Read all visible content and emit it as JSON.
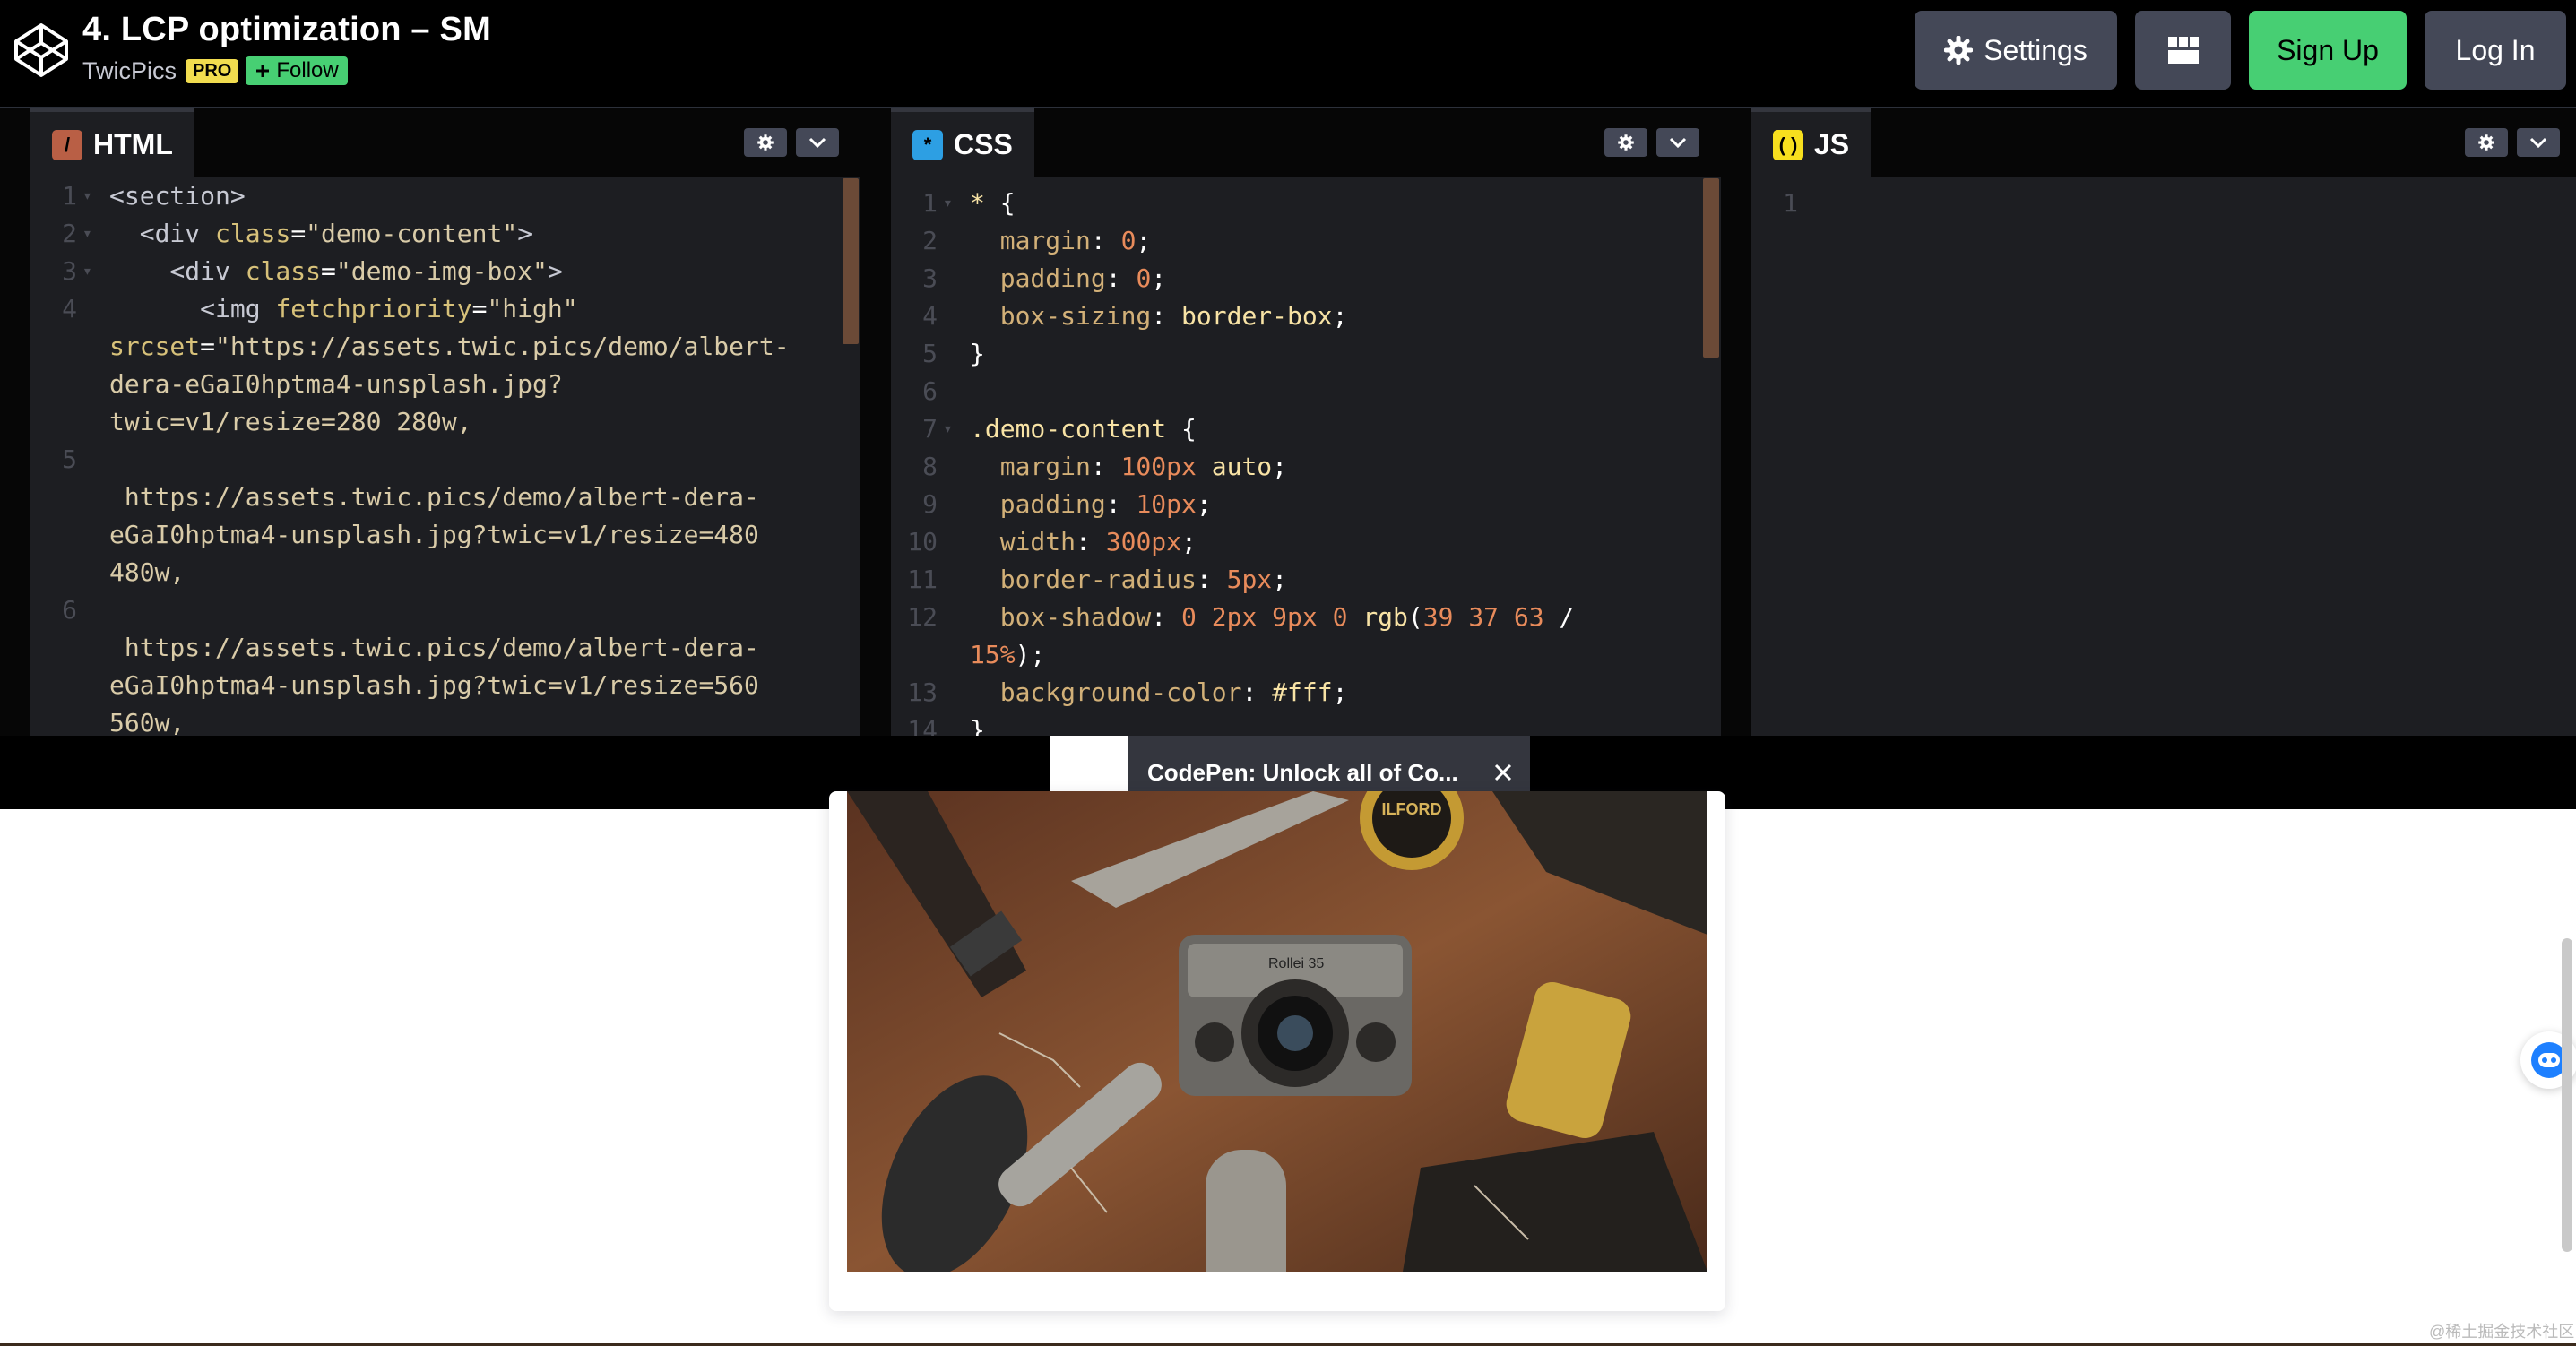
{
  "header": {
    "title": "4. LCP optimization – SM",
    "author": "TwicPics",
    "pro_badge": "PRO",
    "follow_label": "Follow",
    "settings_label": "Settings",
    "signup_label": "Sign Up",
    "login_label": "Log In"
  },
  "panels": {
    "html": {
      "label": "HTML",
      "icon": "/"
    },
    "css": {
      "label": "CSS",
      "icon": "*"
    },
    "js": {
      "label": "JS",
      "icon": "( )"
    }
  },
  "html_code": [
    {
      "n": "1",
      "fold": true,
      "parts": [
        [
          "c-tag",
          "<section>"
        ]
      ]
    },
    {
      "n": "2",
      "fold": true,
      "parts": [
        [
          "c-tag",
          "  <div "
        ],
        [
          "c-attr",
          "class"
        ],
        [
          "c-def",
          "="
        ],
        [
          "c-str",
          "\"demo-content\""
        ],
        [
          "c-tag",
          ">"
        ]
      ]
    },
    {
      "n": "3",
      "fold": true,
      "parts": [
        [
          "c-tag",
          "    <div "
        ],
        [
          "c-attr",
          "class"
        ],
        [
          "c-def",
          "="
        ],
        [
          "c-str",
          "\"demo-img-box\""
        ],
        [
          "c-tag",
          ">"
        ]
      ]
    },
    {
      "n": "4",
      "fold": false,
      "parts": [
        [
          "c-tag",
          "      <img "
        ],
        [
          "c-attr",
          "fetchpriority"
        ],
        [
          "c-def",
          "="
        ],
        [
          "c-str",
          "\"high\""
        ]
      ]
    },
    {
      "n": "",
      "fold": false,
      "parts": [
        [
          "c-attr",
          "srcset"
        ],
        [
          "c-def",
          "="
        ],
        [
          "c-str",
          "\"https://assets.twic.pics/demo/albert-"
        ]
      ]
    },
    {
      "n": "",
      "fold": false,
      "parts": [
        [
          "c-str",
          "dera-eGaI0hptma4-unsplash.jpg?"
        ]
      ]
    },
    {
      "n": "",
      "fold": false,
      "parts": [
        [
          "c-str",
          "twic=v1/resize=280 280w,"
        ]
      ]
    },
    {
      "n": "5",
      "fold": false,
      "parts": [
        [
          "c-def",
          ""
        ]
      ]
    },
    {
      "n": "",
      "fold": false,
      "parts": [
        [
          "c-str",
          " https://assets.twic.pics/demo/albert-dera-"
        ]
      ]
    },
    {
      "n": "",
      "fold": false,
      "parts": [
        [
          "c-str",
          "eGaI0hptma4-unsplash.jpg?twic=v1/resize=480"
        ]
      ]
    },
    {
      "n": "",
      "fold": false,
      "parts": [
        [
          "c-str",
          "480w,"
        ]
      ]
    },
    {
      "n": "6",
      "fold": false,
      "parts": [
        [
          "c-def",
          ""
        ]
      ]
    },
    {
      "n": "",
      "fold": false,
      "parts": [
        [
          "c-str",
          " https://assets.twic.pics/demo/albert-dera-"
        ]
      ]
    },
    {
      "n": "",
      "fold": false,
      "parts": [
        [
          "c-str",
          "eGaI0hptma4-unsplash.jpg?twic=v1/resize=560"
        ]
      ]
    },
    {
      "n": "",
      "fold": false,
      "parts": [
        [
          "c-str",
          "560w,"
        ]
      ]
    }
  ],
  "css_code": [
    {
      "n": "1",
      "fold": true,
      "parts": [
        [
          "c-sel",
          "* "
        ],
        [
          "c-def",
          "{"
        ]
      ]
    },
    {
      "n": "2",
      "fold": false,
      "parts": [
        [
          "c-prop",
          "  margin"
        ],
        [
          "c-def",
          ": "
        ],
        [
          "c-num",
          "0"
        ],
        [
          "c-def",
          ";"
        ]
      ]
    },
    {
      "n": "3",
      "fold": false,
      "parts": [
        [
          "c-prop",
          "  padding"
        ],
        [
          "c-def",
          ": "
        ],
        [
          "c-num",
          "0"
        ],
        [
          "c-def",
          ";"
        ]
      ]
    },
    {
      "n": "4",
      "fold": false,
      "parts": [
        [
          "c-prop",
          "  box-sizing"
        ],
        [
          "c-def",
          ": "
        ],
        [
          "c-sel",
          "border-box"
        ],
        [
          "c-def",
          ";"
        ]
      ]
    },
    {
      "n": "5",
      "fold": false,
      "parts": [
        [
          "c-def",
          "}"
        ]
      ]
    },
    {
      "n": "6",
      "fold": false,
      "parts": [
        [
          "c-def",
          ""
        ]
      ]
    },
    {
      "n": "7",
      "fold": true,
      "parts": [
        [
          "c-sel",
          ".demo-content "
        ],
        [
          "c-def",
          "{"
        ]
      ]
    },
    {
      "n": "8",
      "fold": false,
      "parts": [
        [
          "c-prop",
          "  margin"
        ],
        [
          "c-def",
          ": "
        ],
        [
          "c-num",
          "100px "
        ],
        [
          "c-sel",
          "auto"
        ],
        [
          "c-def",
          ";"
        ]
      ]
    },
    {
      "n": "9",
      "fold": false,
      "parts": [
        [
          "c-prop",
          "  padding"
        ],
        [
          "c-def",
          ": "
        ],
        [
          "c-num",
          "10px"
        ],
        [
          "c-def",
          ";"
        ]
      ]
    },
    {
      "n": "10",
      "fold": false,
      "parts": [
        [
          "c-prop",
          "  width"
        ],
        [
          "c-def",
          ": "
        ],
        [
          "c-num",
          "300px"
        ],
        [
          "c-def",
          ";"
        ]
      ]
    },
    {
      "n": "11",
      "fold": false,
      "parts": [
        [
          "c-prop",
          "  border-radius"
        ],
        [
          "c-def",
          ": "
        ],
        [
          "c-num",
          "5px"
        ],
        [
          "c-def",
          ";"
        ]
      ]
    },
    {
      "n": "12",
      "fold": false,
      "parts": [
        [
          "c-prop",
          "  box-shadow"
        ],
        [
          "c-def",
          ": "
        ],
        [
          "c-num",
          "0 2px 9px 0 "
        ],
        [
          "c-sel",
          "rgb"
        ],
        [
          "c-def",
          "("
        ],
        [
          "c-num",
          "39 37 63 "
        ],
        [
          "c-def",
          "/"
        ]
      ]
    },
    {
      "n": "",
      "fold": false,
      "parts": [
        [
          "c-num",
          "15%"
        ],
        [
          "c-def",
          ");"
        ]
      ]
    },
    {
      "n": "13",
      "fold": false,
      "parts": [
        [
          "c-prop",
          "  background-color"
        ],
        [
          "c-def",
          ": "
        ],
        [
          "c-sel",
          "#fff"
        ],
        [
          "c-def",
          ";"
        ]
      ]
    },
    {
      "n": "14",
      "fold": false,
      "parts": [
        [
          "c-def",
          "}"
        ]
      ]
    }
  ],
  "js_code": [
    {
      "n": "1",
      "fold": false,
      "parts": [
        [
          "c-def",
          ""
        ]
      ]
    }
  ],
  "toast": {
    "text": "CodePen: Unlock all of Co..."
  },
  "preview": {
    "photo_text_1": "ILFORD",
    "photo_text_2": "Rollei 35"
  },
  "watermark": "@稀土掘金技术社区"
}
